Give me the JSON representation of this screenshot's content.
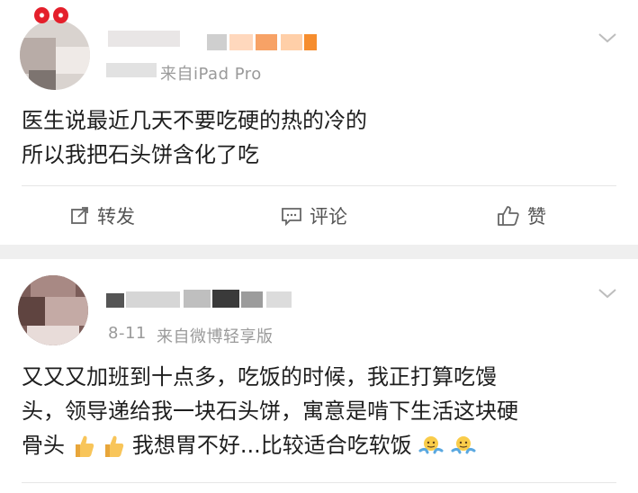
{
  "post1": {
    "meta_suffix": "来自iPad Pro",
    "lines": [
      "医生说最近几天不要吃硬的热的冷的",
      "所以我把石头饼含化了吃"
    ],
    "actions": {
      "repost": "转发",
      "comment": "评论",
      "like": "赞"
    }
  },
  "post2": {
    "date": "8-11",
    "source": "来自微博轻享版",
    "line1": "又又又加班到十点多，吃饭的时候，我正打算吃馒",
    "line2": "头，领导递给我一块石头饼，寓意是啃下生活这块硬",
    "line3_start": "骨头",
    "line3_mid": "我想胃不好...比较适合吃软饭"
  },
  "icons": {
    "repost": "repost-icon",
    "comment": "comment-icon",
    "like": "thumbs-up-icon",
    "chevron": "chevron-down-icon"
  },
  "colors": {
    "accent_gold": "#f2c21d",
    "meta_gray": "#9a9a9a"
  }
}
